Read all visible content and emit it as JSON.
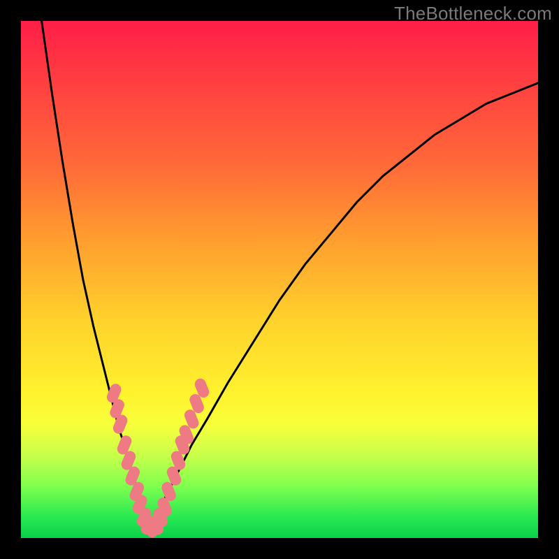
{
  "watermark": "TheBottleneck.com",
  "colors": {
    "frame": "#000000",
    "gradient_top": "#ff1e47",
    "gradient_mid1": "#ff9d2f",
    "gradient_mid2": "#fff22e",
    "gradient_bottom": "#0ad04a",
    "curve": "#000000",
    "marker_fill": "#ee7a83",
    "marker_stroke": "#d85e68"
  },
  "chart_data": {
    "type": "line",
    "title": "",
    "xlabel": "",
    "ylabel": "",
    "xlim": [
      0,
      100
    ],
    "ylim": [
      0,
      100
    ],
    "note": "Bottleneck V-curve. Axis values are estimated from geometry; no tick labels in image.",
    "series": [
      {
        "name": "left-branch",
        "x": [
          4,
          6,
          8,
          10,
          12,
          14,
          16,
          18,
          19,
          20,
          21,
          22,
          23,
          24,
          25
        ],
        "values": [
          100,
          86,
          73,
          61,
          50,
          41,
          33,
          25,
          21,
          18,
          14,
          11,
          8,
          5,
          2
        ]
      },
      {
        "name": "right-branch",
        "x": [
          25,
          27,
          29,
          31,
          33,
          36,
          40,
          45,
          50,
          55,
          60,
          65,
          70,
          75,
          80,
          85,
          90,
          95,
          100
        ],
        "values": [
          2,
          6,
          10,
          14,
          18,
          23,
          30,
          38,
          46,
          53,
          59,
          65,
          70,
          74,
          78,
          81,
          84,
          86,
          88
        ]
      }
    ],
    "markers": {
      "name": "highlighted-points",
      "points": [
        {
          "x": 18.0,
          "y": 28
        },
        {
          "x": 18.6,
          "y": 25
        },
        {
          "x": 19.2,
          "y": 22
        },
        {
          "x": 20.0,
          "y": 18
        },
        {
          "x": 20.8,
          "y": 15
        },
        {
          "x": 21.6,
          "y": 12
        },
        {
          "x": 22.4,
          "y": 9
        },
        {
          "x": 23.0,
          "y": 6.5
        },
        {
          "x": 23.8,
          "y": 4
        },
        {
          "x": 24.6,
          "y": 2.5
        },
        {
          "x": 25.4,
          "y": 2
        },
        {
          "x": 26.2,
          "y": 2.5
        },
        {
          "x": 27.0,
          "y": 4
        },
        {
          "x": 27.8,
          "y": 6
        },
        {
          "x": 28.6,
          "y": 9
        },
        {
          "x": 29.6,
          "y": 12
        },
        {
          "x": 30.4,
          "y": 15
        },
        {
          "x": 31.2,
          "y": 18
        },
        {
          "x": 32.0,
          "y": 20
        },
        {
          "x": 33.0,
          "y": 23
        },
        {
          "x": 34.0,
          "y": 26
        },
        {
          "x": 35.0,
          "y": 29
        }
      ]
    }
  }
}
